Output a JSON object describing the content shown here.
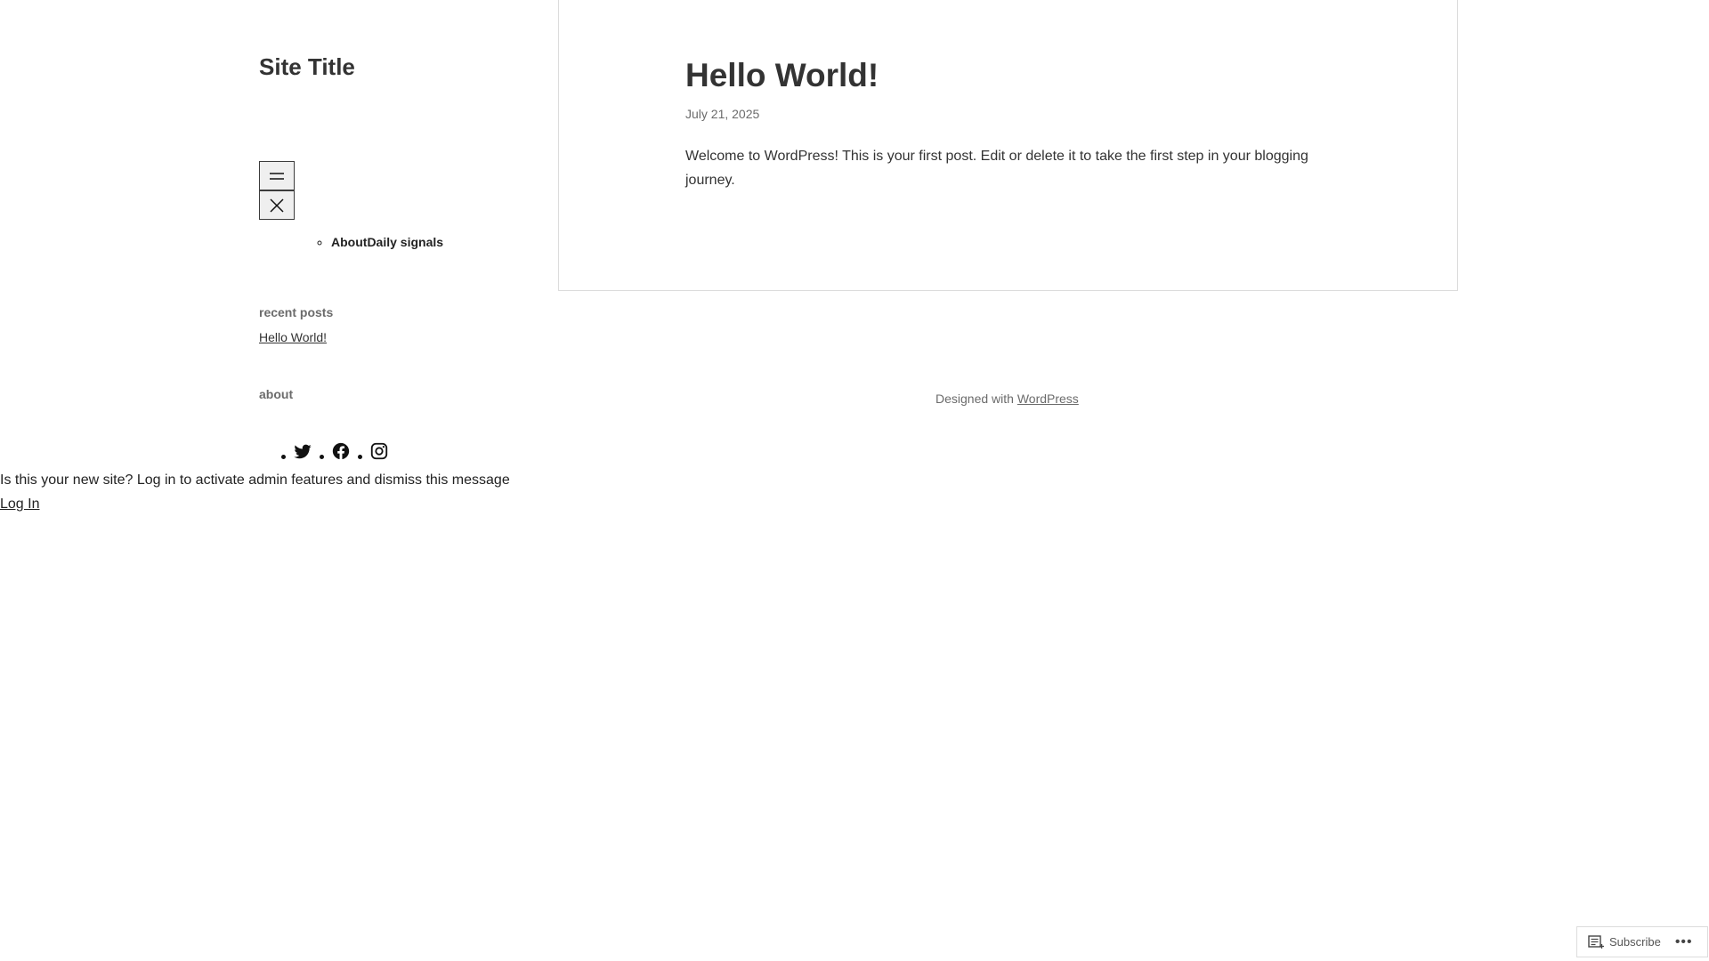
{
  "site": {
    "title": "Site Title"
  },
  "navigation": {
    "open_icon": "menu-icon",
    "close_icon": "close-icon",
    "items": [
      {
        "label": "About"
      },
      {
        "label": "Daily signals"
      }
    ]
  },
  "sidebar": {
    "recent_posts_heading": "recent posts",
    "recent_posts": [
      {
        "label": "Hello World!"
      }
    ],
    "about_heading": "about",
    "social_icons": [
      "twitter-icon",
      "facebook-icon",
      "instagram-icon"
    ]
  },
  "admin_notice": {
    "message": "Is this your new site? Log in to activate admin features and dismiss this message",
    "login_label": "Log In"
  },
  "post": {
    "title": "Hello World!",
    "date": "July 21, 2025",
    "body": "Welcome to WordPress! This is your first post. Edit or delete it to take the first step in your blogging journey."
  },
  "footer": {
    "prefix": "Designed with ",
    "link_label": "WordPress"
  },
  "subscribe_bar": {
    "subscribe_label": "Subscribe",
    "more_label": "•••"
  }
}
